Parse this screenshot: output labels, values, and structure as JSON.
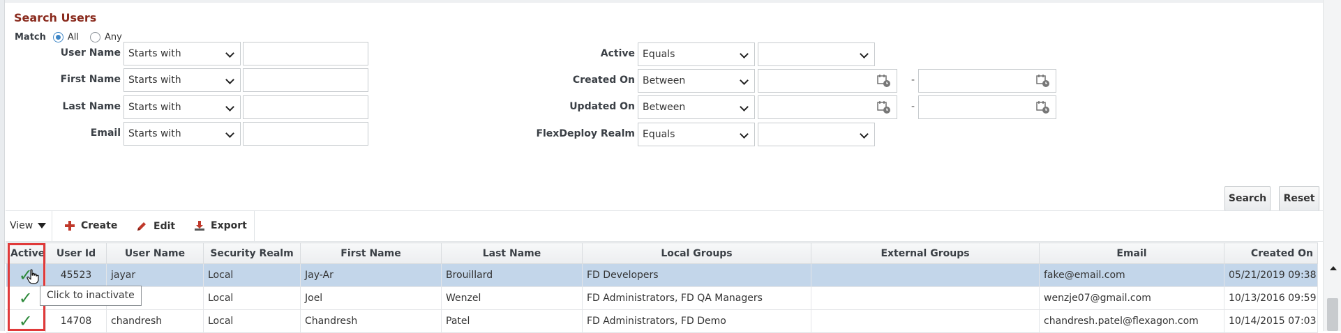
{
  "search": {
    "title": "Search Users",
    "match_label": "Match",
    "match_options": [
      "All",
      "Any"
    ],
    "match_selected": "All",
    "fields": {
      "user_name": {
        "label": "User Name",
        "operator": "Starts with",
        "value": ""
      },
      "first_name": {
        "label": "First Name",
        "operator": "Starts with",
        "value": ""
      },
      "last_name": {
        "label": "Last Name",
        "operator": "Starts with",
        "value": ""
      },
      "email": {
        "label": "Email",
        "operator": "Starts with",
        "value": ""
      },
      "active": {
        "label": "Active",
        "operator": "Equals",
        "value": ""
      },
      "created_on": {
        "label": "Created On",
        "operator": "Between",
        "from": "",
        "to": ""
      },
      "updated_on": {
        "label": "Updated On",
        "operator": "Between",
        "from": "",
        "to": ""
      },
      "realm": {
        "label": "FlexDeploy Realm",
        "operator": "Equals",
        "value": ""
      }
    },
    "range_separator": "-",
    "search_button": "Search",
    "reset_button": "Reset"
  },
  "toolbar": {
    "view": "View",
    "create": "Create",
    "edit": "Edit",
    "export": "Export"
  },
  "table": {
    "headers": [
      "Active",
      "User Id",
      "User Name",
      "Security Realm",
      "First Name",
      "Last Name",
      "Local Groups",
      "External Groups",
      "Email",
      "Created On"
    ],
    "rows": [
      {
        "active": true,
        "user_id": "45523",
        "user_name": "jayar",
        "realm": "Local",
        "first_name": "Jay-Ar",
        "last_name": "Brouillard",
        "local_groups": "FD Developers",
        "external_groups": "",
        "email": "fake@email.com",
        "created_on": "05/21/2019 09:38"
      },
      {
        "active": true,
        "user_id": "",
        "user_name": "",
        "realm": "Local",
        "first_name": "Joel",
        "last_name": "Wenzel",
        "local_groups": "FD Administrators, FD QA Managers",
        "external_groups": "",
        "email": "wenzje07@gmail.com",
        "created_on": "10/13/2016 09:59"
      },
      {
        "active": true,
        "user_id": "14708",
        "user_name": "chandresh",
        "realm": "Local",
        "first_name": "Chandresh",
        "last_name": "Patel",
        "local_groups": "FD Administrators, FD Demo",
        "external_groups": "",
        "email": "chandresh.patel@flexagon.com",
        "created_on": "10/14/2015 07:03"
      }
    ],
    "check_glyph": "✓"
  },
  "tooltip": "Click to inactivate",
  "colors": {
    "title": "#8a2b1e",
    "selected_row": "#c3d6ea",
    "highlight": "#e03a3a",
    "check": "#2f8a3c"
  }
}
